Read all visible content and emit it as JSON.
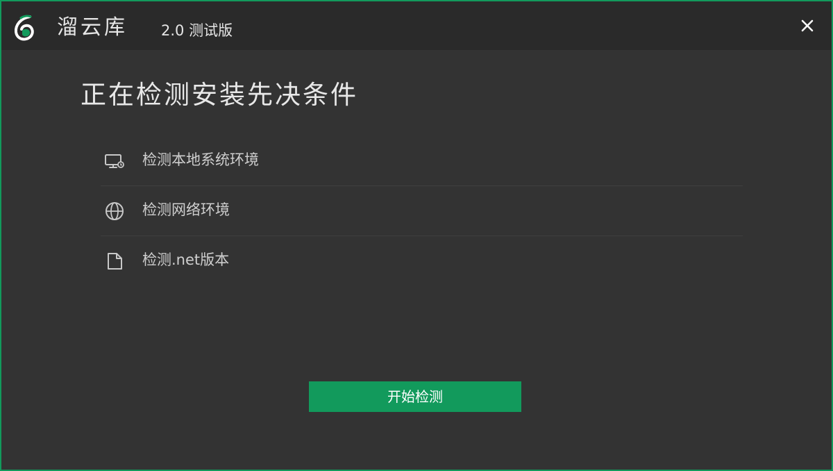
{
  "titlebar": {
    "app_name": "溜云库",
    "version": "2.0 测试版",
    "logo_icon": "leaf-six-logo",
    "close_icon": "close-icon"
  },
  "main": {
    "heading": "正在检测安装先决条件",
    "checks": [
      {
        "icon": "monitor-icon",
        "label": "检测本地系统环境"
      },
      {
        "icon": "globe-icon",
        "label": "检测网络环境"
      },
      {
        "icon": "document-icon",
        "label": "检测.net版本"
      }
    ],
    "start_button_label": "开始检测"
  },
  "colors": {
    "accent": "#129a5c",
    "background": "#333333",
    "titlebar": "#2a2a2a",
    "text": "#cfcfcf"
  }
}
